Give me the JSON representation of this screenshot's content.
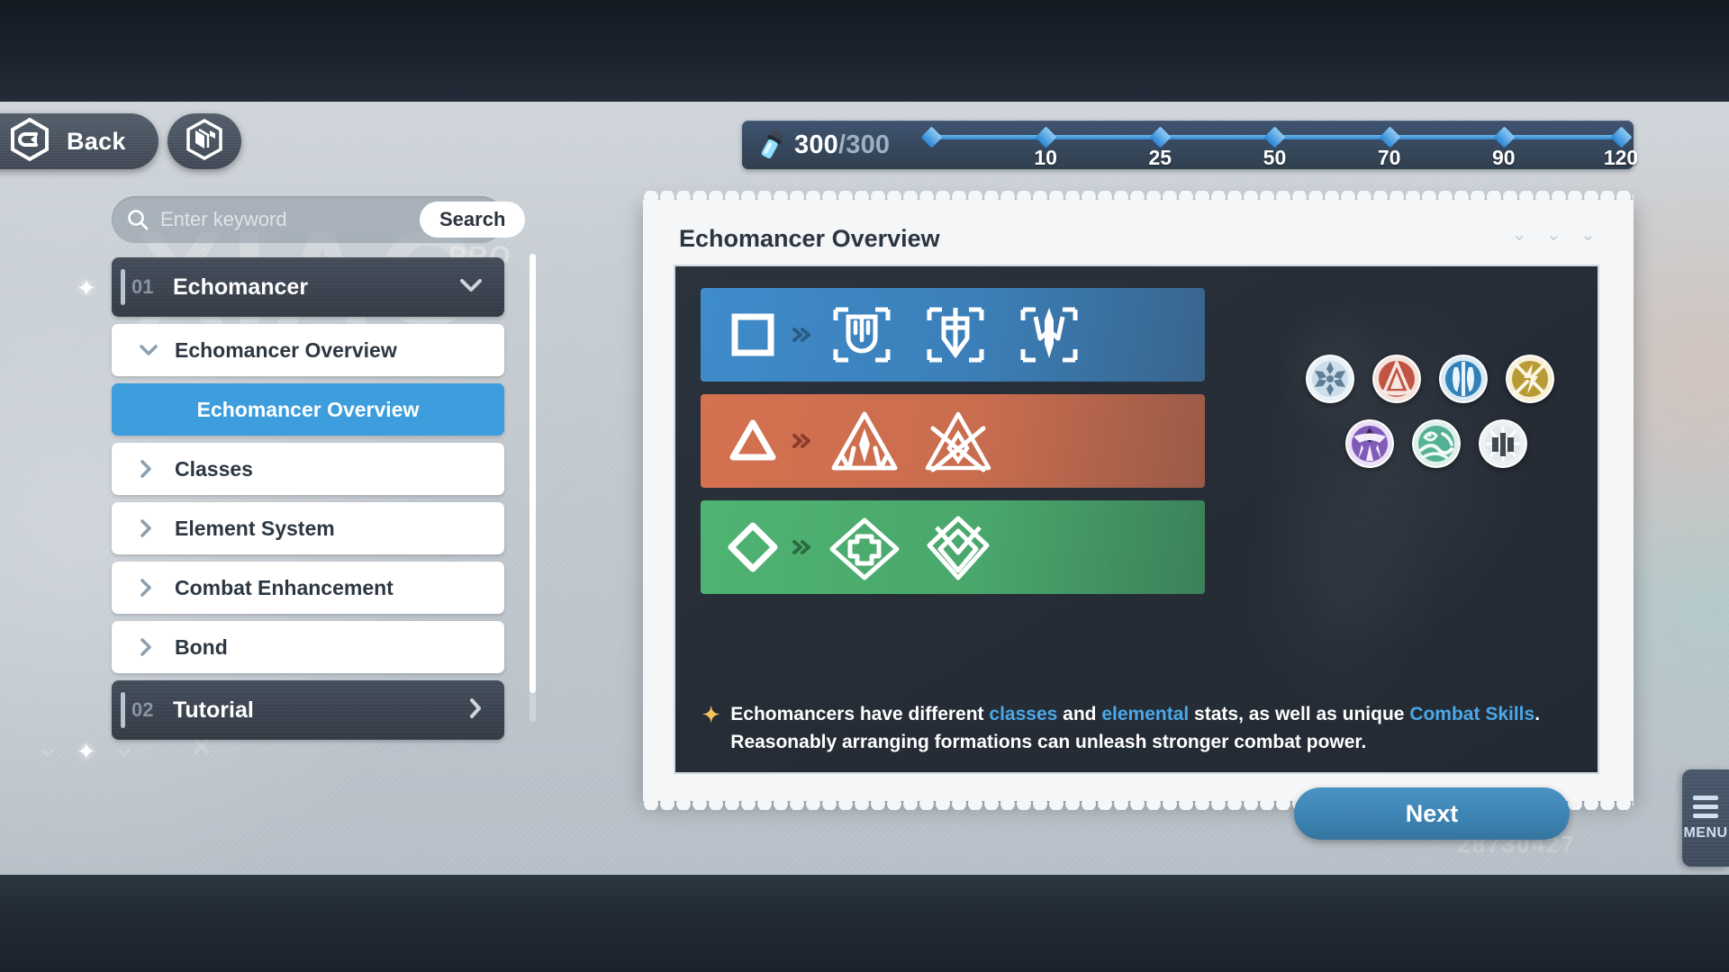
{
  "topbar": {
    "back_label": "Back",
    "back_icon": "hex-back-arrow-icon",
    "codex_icon": "hex-codex-book-icon"
  },
  "energy": {
    "icon": "energy-vial-icon",
    "current": "300",
    "separator": "/",
    "max": "300",
    "milestones": [
      "10",
      "25",
      "50",
      "70",
      "90",
      "120"
    ],
    "accent_color": "#3e9ddc"
  },
  "search": {
    "placeholder": "Enter keyword",
    "value": "",
    "button_label": "Search",
    "icon": "search-icon"
  },
  "sidebar": {
    "chapters": [
      {
        "num": "01",
        "title": "Echomancer",
        "expanded": true,
        "arrow": "chevron-down-icon"
      },
      {
        "num": "02",
        "title": "Tutorial",
        "expanded": false,
        "arrow": "chevron-right-icon"
      }
    ],
    "items": [
      {
        "label": "Echomancer Overview",
        "caret": "chevron-down-icon",
        "state": "expanded"
      },
      {
        "label": "Echomancer Overview",
        "caret": "",
        "state": "selected"
      },
      {
        "label": "Classes",
        "caret": "chevron-right-icon",
        "state": "collapsed"
      },
      {
        "label": "Element System",
        "caret": "chevron-right-icon",
        "state": "collapsed"
      },
      {
        "label": "Combat Enhancement",
        "caret": "chevron-right-icon",
        "state": "collapsed"
      },
      {
        "label": "Bond",
        "caret": "chevron-right-icon",
        "state": "collapsed"
      }
    ]
  },
  "card": {
    "title": "Echomancer Overview",
    "class_rows": [
      {
        "name": "defense-class",
        "base_icon": "square-icon",
        "color": "#3f8ccb",
        "subclass_icons": [
          "shield-guardian-icon",
          "shield-sword-icon",
          "trident-icon"
        ]
      },
      {
        "name": "attack-class",
        "base_icon": "triangle-icon",
        "color": "#d4714f",
        "subclass_icons": [
          "arrow-burst-icon",
          "crossed-blades-icon"
        ]
      },
      {
        "name": "support-class",
        "base_icon": "diamond-icon",
        "color": "#4fb372",
        "subclass_icons": [
          "cross-diamond-icon",
          "interlocked-diamond-icon"
        ]
      }
    ],
    "elements": [
      {
        "name": "ice-element-icon",
        "color": "#9fc3d8"
      },
      {
        "name": "fire-element-icon",
        "color": "#c0503f"
      },
      {
        "name": "water-element-icon",
        "color": "#2f80b8"
      },
      {
        "name": "lightning-element-icon",
        "color": "#b89b35"
      },
      {
        "name": "void-element-icon",
        "color": "#7b53b5"
      },
      {
        "name": "wind-element-icon",
        "color": "#4fae92"
      },
      {
        "name": "physical-element-icon",
        "color": "#9aa3ab"
      }
    ],
    "description": {
      "star": "✦",
      "part1": "Echomancers have different ",
      "link1": "classes",
      "part2": " and ",
      "link2": "elemental",
      "part3": " stats, as well as unique ",
      "link3": "Combat Skills",
      "part4": ". Reasonably arranging formations can unleash stronger combat power."
    },
    "deco": "⌄ ⌄ ⌄"
  },
  "next_button": {
    "label": "Next"
  },
  "menu_button": {
    "label": "MENU",
    "icon": "hamburger-menu-icon"
  },
  "watermark": {
    "big": "XIAO",
    "pro": "PRO",
    "number": "28730427",
    "shapes": "⌄ ⌄ ✕"
  }
}
